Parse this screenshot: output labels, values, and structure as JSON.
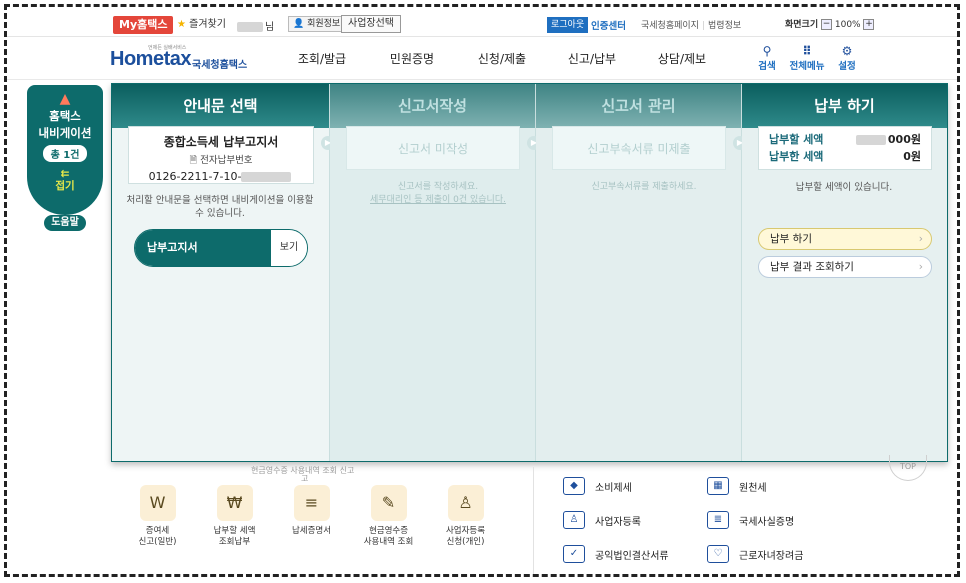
{
  "topbar": {
    "my_hometax": "My홈택스",
    "favorites": "즐겨찾기",
    "user_suffix": "님",
    "member_info": "회원정보",
    "business_select": "사업장선택",
    "logout": "로그아웃",
    "cert_center": "인증센터",
    "links": [
      "국세청홈페이지",
      "법령정보"
    ],
    "screen_size_label": "화면크기",
    "zoom_value": "100%"
  },
  "header": {
    "logo_sub": "언제든 실배서비스",
    "logo_text": "Hometax",
    "logo_kr": "국세청홈택스",
    "nav": [
      "조회/발급",
      "민원증명",
      "신청/제출",
      "신고/납부",
      "상담/제보"
    ],
    "search": "검색",
    "all_menu": "전체메뉴",
    "settings": "설정"
  },
  "navi": {
    "title_1": "홈택스",
    "title_2": "내비게이션",
    "count": "총 1건",
    "fold_arrow": "⇇",
    "fold": "접기",
    "help": "도움말"
  },
  "panel": {
    "step1": {
      "header": "안내문 선택",
      "card_title": "종합소득세 납부고지서",
      "card_sub": "전자납부번호",
      "card_number_prefix": "0126-2211-7-10-",
      "note": "처리할 안내문을 선택하면 내비게이션을 이용할 수 있습니다.",
      "bill_label": "납부고지서",
      "view_label": "보기"
    },
    "step2": {
      "header": "신고서작성",
      "card": "신고서 미작성",
      "note_1": "신고서를 작성하세요.",
      "note_2": "세무대리인 등 제출이 0건 있습니다."
    },
    "step3": {
      "header": "신고서 관리",
      "card": "신고부속서류 미제출",
      "note": "신고부속서류를 제출하세요."
    },
    "step4": {
      "header": "납부 하기",
      "due_label": "납부할 세액",
      "due_value_suffix": "000원",
      "paid_label": "납부한 세액",
      "paid_value": "0원",
      "note": "납부할 세액이 있습니다.",
      "pay_button": "납부 하기",
      "result_button": "납부 결과 조회하기"
    }
  },
  "bottom": {
    "partial_labels": [
      "현금영수증 사용내역 조회 신고",
      "고"
    ],
    "icons": [
      {
        "label_1": "증여세",
        "label_2": "신고(일반)",
        "glyph": "W"
      },
      {
        "label_1": "납부할 세액",
        "label_2": "조회납부",
        "glyph": "₩"
      },
      {
        "label_1": "납세증명서",
        "label_2": "",
        "glyph": "≡"
      },
      {
        "label_1": "현금영수증",
        "label_2": "사용내역 조회",
        "glyph": "✎"
      },
      {
        "label_1": "사업자등록",
        "label_2": "신청(개인)",
        "glyph": "♙"
      }
    ],
    "right_col1": [
      "소비제세",
      "사업자등록",
      "공익법인결산서류"
    ],
    "right_col2": [
      "원천세",
      "국세사실증명",
      "근로자녀장려금"
    ],
    "top_button": "TOP"
  }
}
